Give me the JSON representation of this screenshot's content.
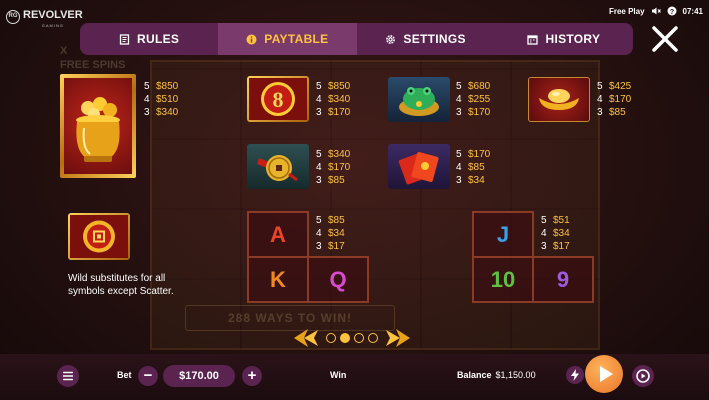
{
  "brand": {
    "name": "REVOLVER",
    "sub": "GAMING",
    "mark": "RG"
  },
  "status": {
    "mode": "Free Play",
    "time": "07:41"
  },
  "background": {
    "free_spins_lines": [
      "X",
      "FREE SPINS"
    ],
    "ways_text": "288 WAYS TO WIN!"
  },
  "nav": {
    "tabs": [
      {
        "label": "RULES",
        "icon": "book-icon"
      },
      {
        "label": "PAYTABLE",
        "icon": "info-icon",
        "active": true
      },
      {
        "label": "SETTINGS",
        "icon": "gear-icon"
      },
      {
        "label": "HISTORY",
        "icon": "calendar-icon"
      }
    ]
  },
  "paytable": {
    "pot": {
      "icon": "gold-pot-icon",
      "pays": [
        [
          "5",
          "$850"
        ],
        [
          "4",
          "$510"
        ],
        [
          "3",
          "$340"
        ]
      ]
    },
    "eight": {
      "icon": "lucky-eight-icon",
      "pays": [
        [
          "5",
          "$850"
        ],
        [
          "4",
          "$340"
        ],
        [
          "3",
          "$170"
        ]
      ]
    },
    "frog": {
      "icon": "jade-frog-icon",
      "pays": [
        [
          "5",
          "$680"
        ],
        [
          "4",
          "$255"
        ],
        [
          "3",
          "$170"
        ]
      ]
    },
    "ingot": {
      "icon": "gold-ingot-icon",
      "pays": [
        [
          "5",
          "$425"
        ],
        [
          "4",
          "$170"
        ],
        [
          "3",
          "$85"
        ]
      ]
    },
    "coin": {
      "icon": "chinese-coin-icon",
      "pays": [
        [
          "5",
          "$340"
        ],
        [
          "4",
          "$170"
        ],
        [
          "3",
          "$85"
        ]
      ]
    },
    "envelope": {
      "icon": "red-envelope-icon",
      "pays": [
        [
          "5",
          "$170"
        ],
        [
          "4",
          "$85"
        ],
        [
          "3",
          "$34"
        ]
      ]
    },
    "royals": {
      "symbols": [
        "A",
        "K",
        "Q"
      ],
      "pays": [
        [
          "5",
          "$85"
        ],
        [
          "4",
          "$34"
        ],
        [
          "3",
          "$17"
        ]
      ]
    },
    "lows": {
      "symbols": [
        "J",
        "10",
        "9"
      ],
      "pays": [
        [
          "5",
          "$51"
        ],
        [
          "4",
          "$34"
        ],
        [
          "3",
          "$17"
        ]
      ]
    },
    "wild": {
      "icon": "wild-medallion-icon",
      "text": "Wild substitutes for all symbols except Scatter."
    }
  },
  "pager": {
    "pages": 4,
    "current": 2
  },
  "bottom": {
    "bet_label": "Bet",
    "bet_value": "$170.00",
    "win_label": "Win",
    "balance_label": "Balance",
    "balance_value": "$1,150.00"
  },
  "colors": {
    "accent": "#ffc23d",
    "nav": "#5b2350",
    "nav_active": "#7a3a6b",
    "spin": "#e8762a"
  }
}
